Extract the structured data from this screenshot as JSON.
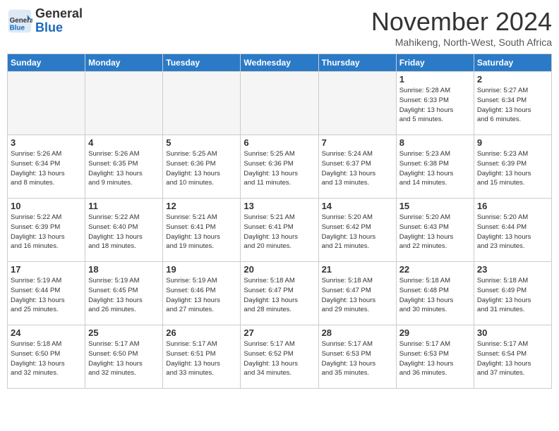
{
  "header": {
    "logo_general": "General",
    "logo_blue": "Blue",
    "month": "November 2024",
    "location": "Mahikeng, North-West, South Africa"
  },
  "days_of_week": [
    "Sunday",
    "Monday",
    "Tuesday",
    "Wednesday",
    "Thursday",
    "Friday",
    "Saturday"
  ],
  "weeks": [
    [
      {
        "day": "",
        "info": ""
      },
      {
        "day": "",
        "info": ""
      },
      {
        "day": "",
        "info": ""
      },
      {
        "day": "",
        "info": ""
      },
      {
        "day": "",
        "info": ""
      },
      {
        "day": "1",
        "info": "Sunrise: 5:28 AM\nSunset: 6:33 PM\nDaylight: 13 hours\nand 5 minutes."
      },
      {
        "day": "2",
        "info": "Sunrise: 5:27 AM\nSunset: 6:34 PM\nDaylight: 13 hours\nand 6 minutes."
      }
    ],
    [
      {
        "day": "3",
        "info": "Sunrise: 5:26 AM\nSunset: 6:34 PM\nDaylight: 13 hours\nand 8 minutes."
      },
      {
        "day": "4",
        "info": "Sunrise: 5:26 AM\nSunset: 6:35 PM\nDaylight: 13 hours\nand 9 minutes."
      },
      {
        "day": "5",
        "info": "Sunrise: 5:25 AM\nSunset: 6:36 PM\nDaylight: 13 hours\nand 10 minutes."
      },
      {
        "day": "6",
        "info": "Sunrise: 5:25 AM\nSunset: 6:36 PM\nDaylight: 13 hours\nand 11 minutes."
      },
      {
        "day": "7",
        "info": "Sunrise: 5:24 AM\nSunset: 6:37 PM\nDaylight: 13 hours\nand 13 minutes."
      },
      {
        "day": "8",
        "info": "Sunrise: 5:23 AM\nSunset: 6:38 PM\nDaylight: 13 hours\nand 14 minutes."
      },
      {
        "day": "9",
        "info": "Sunrise: 5:23 AM\nSunset: 6:39 PM\nDaylight: 13 hours\nand 15 minutes."
      }
    ],
    [
      {
        "day": "10",
        "info": "Sunrise: 5:22 AM\nSunset: 6:39 PM\nDaylight: 13 hours\nand 16 minutes."
      },
      {
        "day": "11",
        "info": "Sunrise: 5:22 AM\nSunset: 6:40 PM\nDaylight: 13 hours\nand 18 minutes."
      },
      {
        "day": "12",
        "info": "Sunrise: 5:21 AM\nSunset: 6:41 PM\nDaylight: 13 hours\nand 19 minutes."
      },
      {
        "day": "13",
        "info": "Sunrise: 5:21 AM\nSunset: 6:41 PM\nDaylight: 13 hours\nand 20 minutes."
      },
      {
        "day": "14",
        "info": "Sunrise: 5:20 AM\nSunset: 6:42 PM\nDaylight: 13 hours\nand 21 minutes."
      },
      {
        "day": "15",
        "info": "Sunrise: 5:20 AM\nSunset: 6:43 PM\nDaylight: 13 hours\nand 22 minutes."
      },
      {
        "day": "16",
        "info": "Sunrise: 5:20 AM\nSunset: 6:44 PM\nDaylight: 13 hours\nand 23 minutes."
      }
    ],
    [
      {
        "day": "17",
        "info": "Sunrise: 5:19 AM\nSunset: 6:44 PM\nDaylight: 13 hours\nand 25 minutes."
      },
      {
        "day": "18",
        "info": "Sunrise: 5:19 AM\nSunset: 6:45 PM\nDaylight: 13 hours\nand 26 minutes."
      },
      {
        "day": "19",
        "info": "Sunrise: 5:19 AM\nSunset: 6:46 PM\nDaylight: 13 hours\nand 27 minutes."
      },
      {
        "day": "20",
        "info": "Sunrise: 5:18 AM\nSunset: 6:47 PM\nDaylight: 13 hours\nand 28 minutes."
      },
      {
        "day": "21",
        "info": "Sunrise: 5:18 AM\nSunset: 6:47 PM\nDaylight: 13 hours\nand 29 minutes."
      },
      {
        "day": "22",
        "info": "Sunrise: 5:18 AM\nSunset: 6:48 PM\nDaylight: 13 hours\nand 30 minutes."
      },
      {
        "day": "23",
        "info": "Sunrise: 5:18 AM\nSunset: 6:49 PM\nDaylight: 13 hours\nand 31 minutes."
      }
    ],
    [
      {
        "day": "24",
        "info": "Sunrise: 5:18 AM\nSunset: 6:50 PM\nDaylight: 13 hours\nand 32 minutes."
      },
      {
        "day": "25",
        "info": "Sunrise: 5:17 AM\nSunset: 6:50 PM\nDaylight: 13 hours\nand 32 minutes."
      },
      {
        "day": "26",
        "info": "Sunrise: 5:17 AM\nSunset: 6:51 PM\nDaylight: 13 hours\nand 33 minutes."
      },
      {
        "day": "27",
        "info": "Sunrise: 5:17 AM\nSunset: 6:52 PM\nDaylight: 13 hours\nand 34 minutes."
      },
      {
        "day": "28",
        "info": "Sunrise: 5:17 AM\nSunset: 6:53 PM\nDaylight: 13 hours\nand 35 minutes."
      },
      {
        "day": "29",
        "info": "Sunrise: 5:17 AM\nSunset: 6:53 PM\nDaylight: 13 hours\nand 36 minutes."
      },
      {
        "day": "30",
        "info": "Sunrise: 5:17 AM\nSunset: 6:54 PM\nDaylight: 13 hours\nand 37 minutes."
      }
    ]
  ]
}
